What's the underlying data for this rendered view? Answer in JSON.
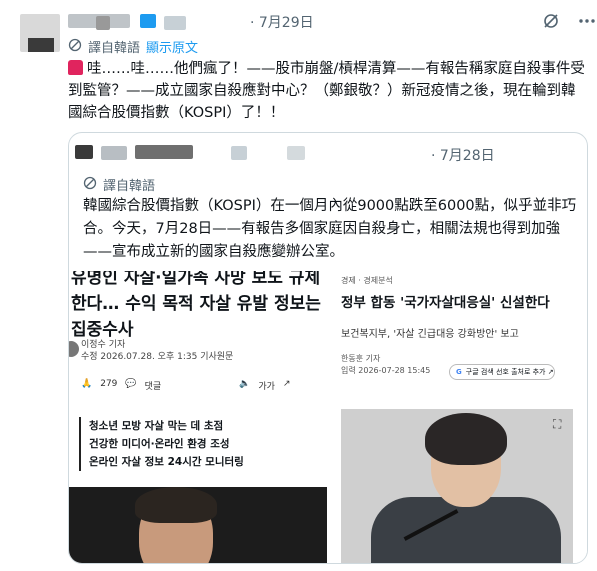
{
  "post": {
    "date": "· 7月29日",
    "translate_label": "譯自韓語",
    "show_original": "顯示原文",
    "text": "哇……哇……他們瘋了！——股市崩盤/槓桿清算——有報告稱家庭自殺事件受到監管？——成立國家自殺應對中心？（鄭銀敬？）新冠疫情之後，現在輪到韓國綜合股價指數（KOSPI）了！！",
    "icons": [
      "grok-icon",
      "more-icon",
      "siren-icon"
    ]
  },
  "quote": {
    "date": "· 7月28日",
    "translate_label": "譯自韓語",
    "text": "韓國綜合股價指數（KOSPI）在一個月內從9000點跌至6000點，似乎並非巧合。今天，7月28日——有報告多個家庭因自殺身亡，相關法規也得到加強——宣布成立新的國家自殺應變辦公室。"
  },
  "left_article": {
    "headline": "유명인 자살·일가족 사망 보도 규제한다… 수익 목적 자살 유발 정보는 집중수사",
    "reporter": "이정수 기자",
    "time": "수정 2026.07.28. 오후 1:35",
    "tag": "기사원문",
    "likes": "279",
    "comments": "댓글",
    "font_size": "가가",
    "bullets": [
      "청소년 모방 자살 막는 데 초점",
      "건강한 미디어·온라인 환경 조성",
      "온라인 자살 정보 24시간 모니터링"
    ]
  },
  "right_article": {
    "category": "경제 · 경제분석",
    "headline": "정부 합동 '국가자살대응실' 신설한다",
    "sub": "보건복지부, '자살 긴급대응 강화방안' 보고",
    "reporter": "한동훈 기자",
    "time": "입력 2026-07-28 15:45",
    "button": "구글 검색 선호 출처로 추가 ↗"
  },
  "colors": {
    "link": "#1d9bf0",
    "muted": "#536471",
    "border": "#cfd9de"
  }
}
